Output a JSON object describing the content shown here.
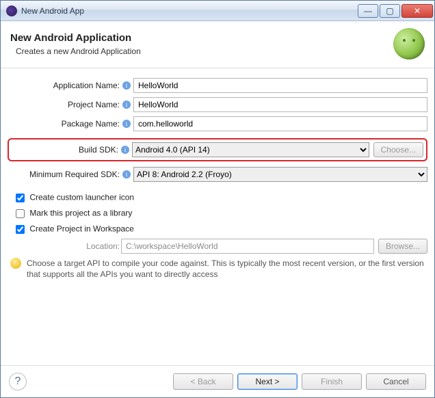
{
  "window": {
    "title": "New Android App"
  },
  "header": {
    "title": "New Android Application",
    "subtitle": "Creates a new Android Application"
  },
  "form": {
    "appName": {
      "label": "Application Name:",
      "value": "HelloWorld"
    },
    "projectName": {
      "label": "Project Name:",
      "value": "HelloWorld"
    },
    "packageName": {
      "label": "Package Name:",
      "value": "com.helloworld"
    },
    "buildSdk": {
      "label": "Build SDK:",
      "value": "Android 4.0 (API 14)",
      "choose": "Choose..."
    },
    "minSdk": {
      "label": "Minimum Required SDK:",
      "value": "API 8: Android 2.2 (Froyo)"
    }
  },
  "checks": {
    "launcherIcon": {
      "label": "Create custom launcher icon",
      "checked": true
    },
    "library": {
      "label": "Mark this project as a library",
      "checked": false
    },
    "workspace": {
      "label": "Create Project in Workspace",
      "checked": true
    }
  },
  "location": {
    "label": "Location:",
    "value": "C:\\workspace\\HelloWorld",
    "browse": "Browse..."
  },
  "hint": "Choose a target API to compile your code against. This is typically the most recent version, or the first version that supports all the APIs you want to directly access",
  "footer": {
    "back": "< Back",
    "next": "Next >",
    "finish": "Finish",
    "cancel": "Cancel"
  }
}
